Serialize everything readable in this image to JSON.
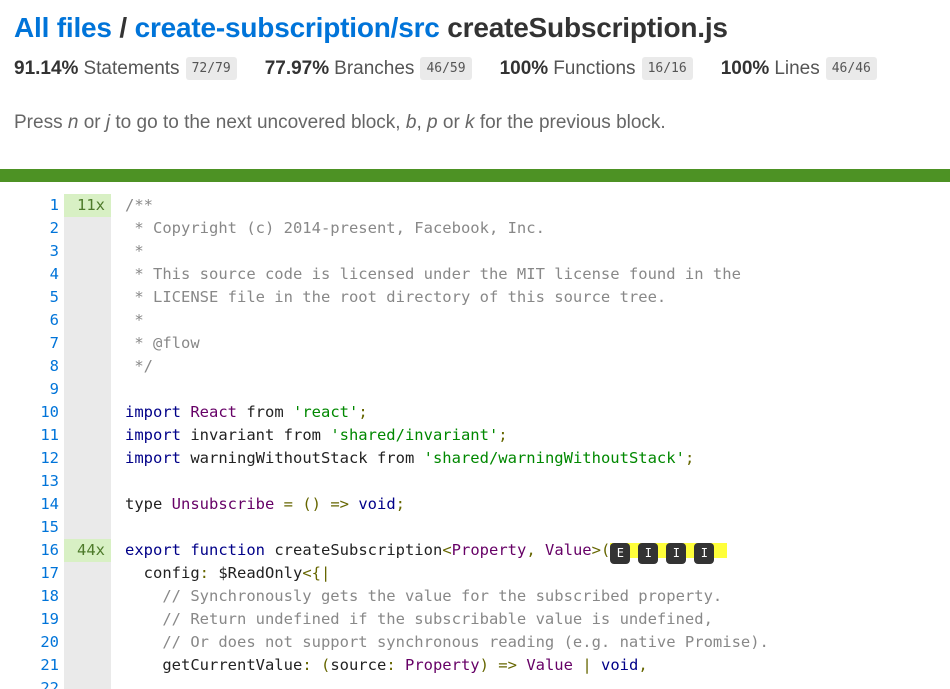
{
  "header": {
    "crumb_root": "All files",
    "crumb_sep": "/",
    "crumb_dir": "create-subscription/src",
    "file_name": "createSubscription.js"
  },
  "stats": {
    "statements": {
      "pct": "91.14%",
      "label": "Statements",
      "frac": "72/79"
    },
    "branches": {
      "pct": "77.97%",
      "label": "Branches",
      "frac": "46/59"
    },
    "functions": {
      "pct": "100%",
      "label": "Functions",
      "frac": "16/16"
    },
    "lines": {
      "pct": "100%",
      "label": "Lines",
      "frac": "46/46"
    }
  },
  "hint": {
    "t1": "Press ",
    "k1": "n",
    "t2": " or ",
    "k2": "j",
    "t3": " to go to the next uncovered block, ",
    "k3": "b",
    "t4": ", ",
    "k4": "p",
    "t5": " or ",
    "k5": "k",
    "t6": " for the previous block."
  },
  "colors": {
    "status_high": "#4d9224",
    "link": "#0074d9",
    "hit_bg": "#d8f0c4"
  },
  "badges": [
    "E",
    "I",
    "I",
    "I"
  ],
  "code": {
    "lines": [
      {
        "n": "1",
        "count": "11x",
        "parts": [
          [
            "cm",
            "/**"
          ]
        ]
      },
      {
        "n": "2",
        "count": "",
        "parts": [
          [
            "cm",
            " * Copyright (c) 2014-present, Facebook, Inc."
          ]
        ]
      },
      {
        "n": "3",
        "count": "",
        "parts": [
          [
            "cm",
            " *"
          ]
        ]
      },
      {
        "n": "4",
        "count": "",
        "parts": [
          [
            "cm",
            " * This source code is licensed under the MIT license found in the"
          ]
        ]
      },
      {
        "n": "5",
        "count": "",
        "parts": [
          [
            "cm",
            " * LICENSE file in the root directory of this source tree."
          ]
        ]
      },
      {
        "n": "6",
        "count": "",
        "parts": [
          [
            "cm",
            " *"
          ]
        ]
      },
      {
        "n": "7",
        "count": "",
        "parts": [
          [
            "cm",
            " * @flow"
          ]
        ]
      },
      {
        "n": "8",
        "count": "",
        "parts": [
          [
            "cm",
            " */"
          ]
        ]
      },
      {
        "n": "9",
        "count": "",
        "parts": []
      },
      {
        "n": "10",
        "count": "",
        "parts": [
          [
            "kw",
            "import"
          ],
          [
            "",
            " "
          ],
          [
            "ty",
            "React"
          ],
          [
            "",
            " from "
          ],
          [
            "st",
            "'react'"
          ],
          [
            "pu",
            ";"
          ]
        ]
      },
      {
        "n": "11",
        "count": "",
        "parts": [
          [
            "kw",
            "import"
          ],
          [
            "",
            " invariant from "
          ],
          [
            "st",
            "'shared/invariant'"
          ],
          [
            "pu",
            ";"
          ]
        ]
      },
      {
        "n": "12",
        "count": "",
        "parts": [
          [
            "kw",
            "import"
          ],
          [
            "",
            " warningWithoutStack from "
          ],
          [
            "st",
            "'shared/warningWithoutStack'"
          ],
          [
            "pu",
            ";"
          ]
        ]
      },
      {
        "n": "13",
        "count": "",
        "parts": []
      },
      {
        "n": "14",
        "count": "",
        "parts": [
          [
            "",
            "type "
          ],
          [
            "ty",
            "Unsubscribe"
          ],
          [
            "pu",
            " = () => "
          ],
          [
            "kw",
            "void"
          ],
          [
            "pu",
            ";"
          ]
        ]
      },
      {
        "n": "15",
        "count": "",
        "parts": []
      },
      {
        "n": "16",
        "count": "44x",
        "badges": true,
        "parts": [
          [
            "kw",
            "export"
          ],
          [
            "",
            " "
          ],
          [
            "kw",
            "function"
          ],
          [
            "",
            " createSubscription"
          ],
          [
            "pu",
            "<"
          ],
          [
            "ty",
            "Property"
          ],
          [
            "pu",
            ", "
          ],
          [
            "ty",
            "Value"
          ],
          [
            "pu",
            ">("
          ]
        ]
      },
      {
        "n": "17",
        "count": "",
        "parts": [
          [
            "",
            "  config"
          ],
          [
            "pu",
            ": "
          ],
          [
            "",
            "$ReadOnly"
          ],
          [
            "pu",
            "<{|"
          ]
        ]
      },
      {
        "n": "18",
        "count": "",
        "parts": [
          [
            "cm",
            "    // Synchronously gets the value for the subscribed property."
          ]
        ]
      },
      {
        "n": "19",
        "count": "",
        "parts": [
          [
            "cm",
            "    // Return undefined if the subscribable value is undefined,"
          ]
        ]
      },
      {
        "n": "20",
        "count": "",
        "parts": [
          [
            "cm",
            "    // Or does not support synchronous reading (e.g. native Promise)."
          ]
        ]
      },
      {
        "n": "21",
        "count": "",
        "parts": [
          [
            "",
            "    getCurrentValue"
          ],
          [
            "pu",
            ": ("
          ],
          [
            "",
            "source"
          ],
          [
            "pu",
            ": "
          ],
          [
            "ty",
            "Property"
          ],
          [
            "pu",
            ") => "
          ],
          [
            "ty",
            "Value"
          ],
          [
            "pu",
            " | "
          ],
          [
            "kw",
            "void"
          ],
          [
            "pu",
            ","
          ]
        ]
      },
      {
        "n": "22",
        "count": "",
        "parts": []
      }
    ]
  }
}
